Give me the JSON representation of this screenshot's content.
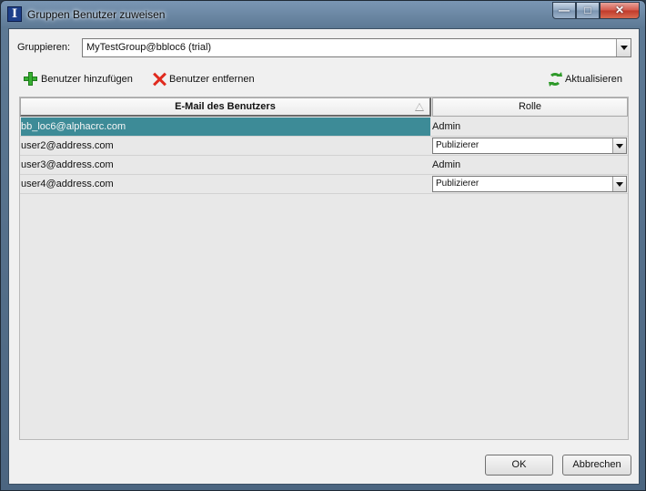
{
  "window": {
    "title": "Gruppen Benutzer zuweisen",
    "caption_buttons": {
      "minimize": "minimize-icon",
      "maximize": "maximize-icon",
      "close": "close-icon"
    }
  },
  "group": {
    "label": "Gruppieren:",
    "selected": "MyTestGroup@bbloc6 (trial)"
  },
  "toolbar": {
    "add_label": "Benutzer hinzufügen",
    "remove_label": "Benutzer entfernen",
    "refresh_label": "Aktualisieren"
  },
  "table": {
    "columns": [
      "E-Mail des Benutzers",
      "Rolle"
    ],
    "rows": [
      {
        "email": "bb_loc6@alphacrc.com",
        "role": "Admin",
        "role_editable": false,
        "selected": true
      },
      {
        "email": "user2@address.com",
        "role": "Publizierer",
        "role_editable": true,
        "selected": false
      },
      {
        "email": "user3@address.com",
        "role": "Admin",
        "role_editable": false,
        "selected": false
      },
      {
        "email": "user4@address.com",
        "role": "Publizierer",
        "role_editable": true,
        "selected": false
      }
    ]
  },
  "buttons": {
    "ok": "OK",
    "cancel": "Abbrechen"
  },
  "colors": {
    "selection": "#3d8b97",
    "add_icon": "#38b032",
    "remove_icon": "#e02a1e",
    "refresh_icon": "#2f9a2a"
  }
}
